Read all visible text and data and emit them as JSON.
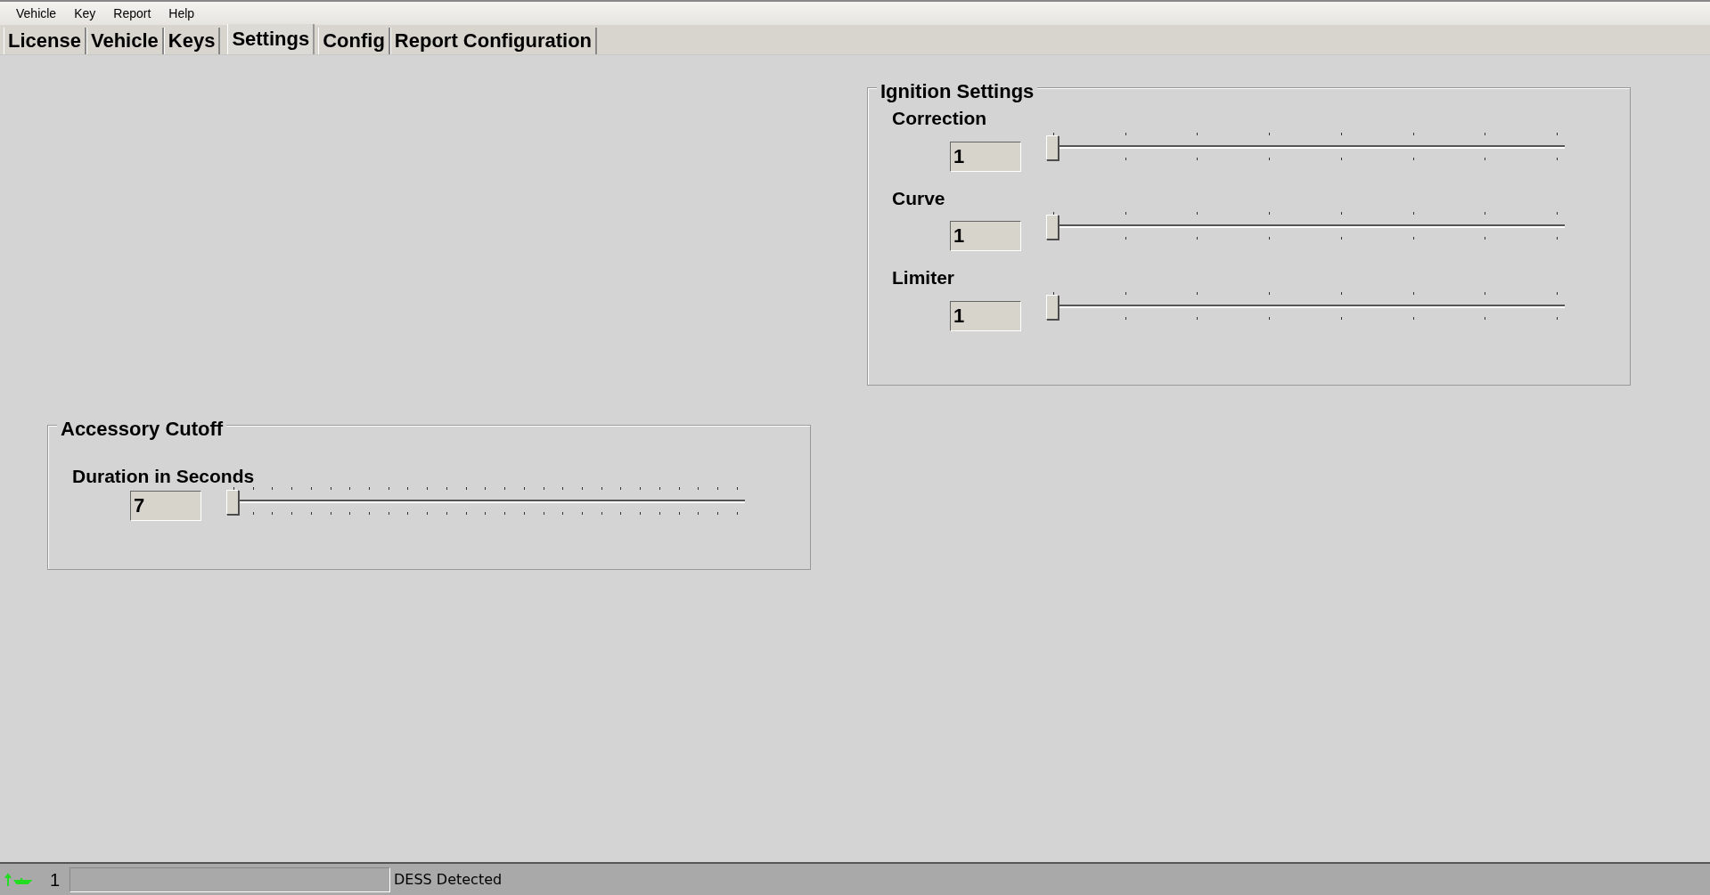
{
  "menu": [
    "Vehicle",
    "Key",
    "Report",
    "Help"
  ],
  "tabs": [
    {
      "label": "License",
      "selected": false
    },
    {
      "label": "Vehicle",
      "selected": false
    },
    {
      "label": "Keys",
      "selected": false
    },
    {
      "label": "Settings",
      "selected": true
    },
    {
      "label": "Config",
      "selected": false
    },
    {
      "label": "Report Configuration",
      "selected": false
    }
  ],
  "groups": [
    {
      "title": "Ignition Settings",
      "settings": [
        {
          "label": "Correction",
          "value": "1",
          "level": 0
        },
        {
          "label": "Curve",
          "value": "1",
          "level": 0
        },
        {
          "label": "Limiter",
          "value": "1",
          "level": 0
        }
      ]
    },
    {
      "title": "Accessory Cutoff",
      "settings": [
        {
          "label": "Duration in Seconds",
          "value": "7",
          "level": 0
        }
      ]
    }
  ],
  "status_bar": {
    "count": "1",
    "message": "DESS Detected"
  }
}
